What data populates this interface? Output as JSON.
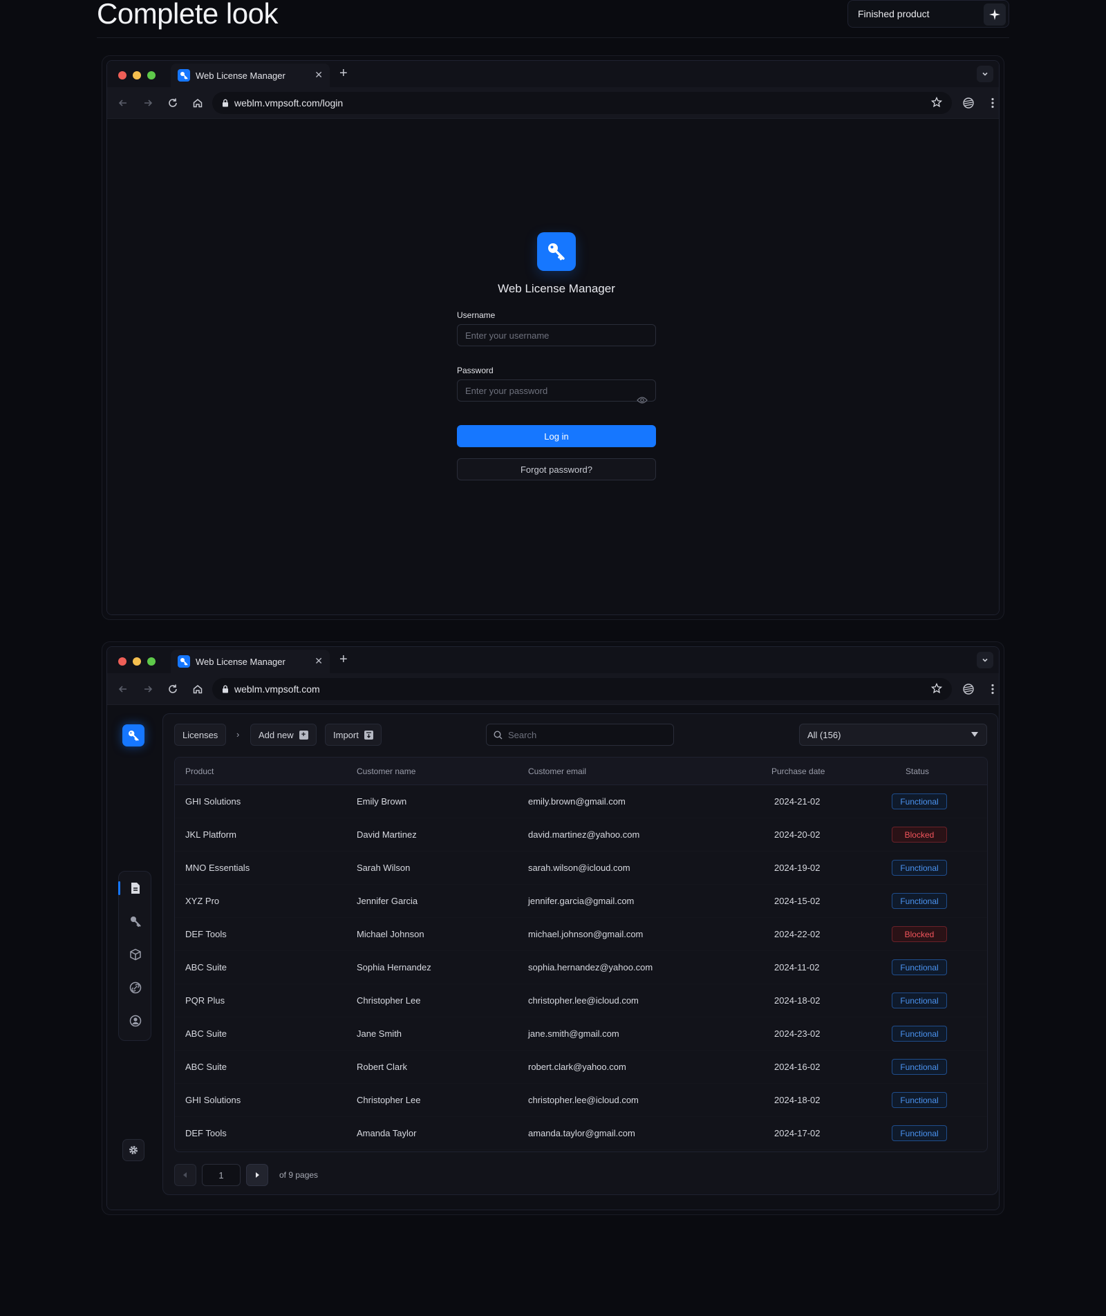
{
  "header": {
    "title": "Complete look",
    "badge_label": "Finished product"
  },
  "colors": {
    "accent": "#1677ff",
    "traffic_red": "#ee5f57",
    "traffic_yellow": "#f5bf4f",
    "traffic_green": "#5ec94a",
    "status_functional": "#4b93f0",
    "status_blocked": "#f2545b"
  },
  "login_window": {
    "tab_title": "Web License Manager",
    "url": "weblm.vmpsoft.com/login",
    "app_name": "Web License Manager",
    "username_label": "Username",
    "username_placeholder": "Enter your username",
    "password_label": "Password",
    "password_placeholder": "Enter your password",
    "login_button": "Log in",
    "forgot_button": "Forgot password?"
  },
  "app_window": {
    "tab_title": "Web License Manager",
    "url": "weblm.vmpsoft.com",
    "breadcrumb": "Licenses",
    "add_new": "Add new",
    "import": "Import",
    "search_placeholder": "Search",
    "filter_value": "All (156)",
    "sidebar_icons": [
      "document-icon",
      "key-icon",
      "box-icon",
      "link-icon",
      "user-icon"
    ],
    "columns": [
      "Product",
      "Customer name",
      "Customer email",
      "Purchase date",
      "Status"
    ],
    "rows": [
      {
        "product": "GHI Solutions",
        "customer": "Emily Brown",
        "email": "emily.brown@gmail.com",
        "date": "2024-21-02",
        "status": "Functional"
      },
      {
        "product": "JKL Platform",
        "customer": "David Martinez",
        "email": "david.martinez@yahoo.com",
        "date": "2024-20-02",
        "status": "Blocked"
      },
      {
        "product": "MNO Essentials",
        "customer": "Sarah Wilson",
        "email": "sarah.wilson@icloud.com",
        "date": "2024-19-02",
        "status": "Functional"
      },
      {
        "product": "XYZ Pro",
        "customer": "Jennifer Garcia",
        "email": "jennifer.garcia@gmail.com",
        "date": "2024-15-02",
        "status": "Functional"
      },
      {
        "product": "DEF Tools",
        "customer": "Michael Johnson",
        "email": "michael.johnson@gmail.com",
        "date": "2024-22-02",
        "status": "Blocked"
      },
      {
        "product": "ABC Suite",
        "customer": "Sophia Hernandez",
        "email": "sophia.hernandez@yahoo.com",
        "date": "2024-11-02",
        "status": "Functional"
      },
      {
        "product": "PQR Plus",
        "customer": "Christopher Lee",
        "email": "christopher.lee@icloud.com",
        "date": "2024-18-02",
        "status": "Functional"
      },
      {
        "product": "ABC Suite",
        "customer": "Jane Smith",
        "email": "jane.smith@gmail.com",
        "date": "2024-23-02",
        "status": "Functional"
      },
      {
        "product": "ABC Suite",
        "customer": "Robert Clark",
        "email": "robert.clark@yahoo.com",
        "date": "2024-16-02",
        "status": "Functional"
      },
      {
        "product": "GHI Solutions",
        "customer": "Christopher Lee",
        "email": "christopher.lee@icloud.com",
        "date": "2024-18-02",
        "status": "Functional"
      },
      {
        "product": "DEF Tools",
        "customer": "Amanda Taylor",
        "email": "amanda.taylor@gmail.com",
        "date": "2024-17-02",
        "status": "Functional"
      }
    ],
    "pagination": {
      "current_page": "1",
      "total_label": "of 9 pages"
    }
  }
}
